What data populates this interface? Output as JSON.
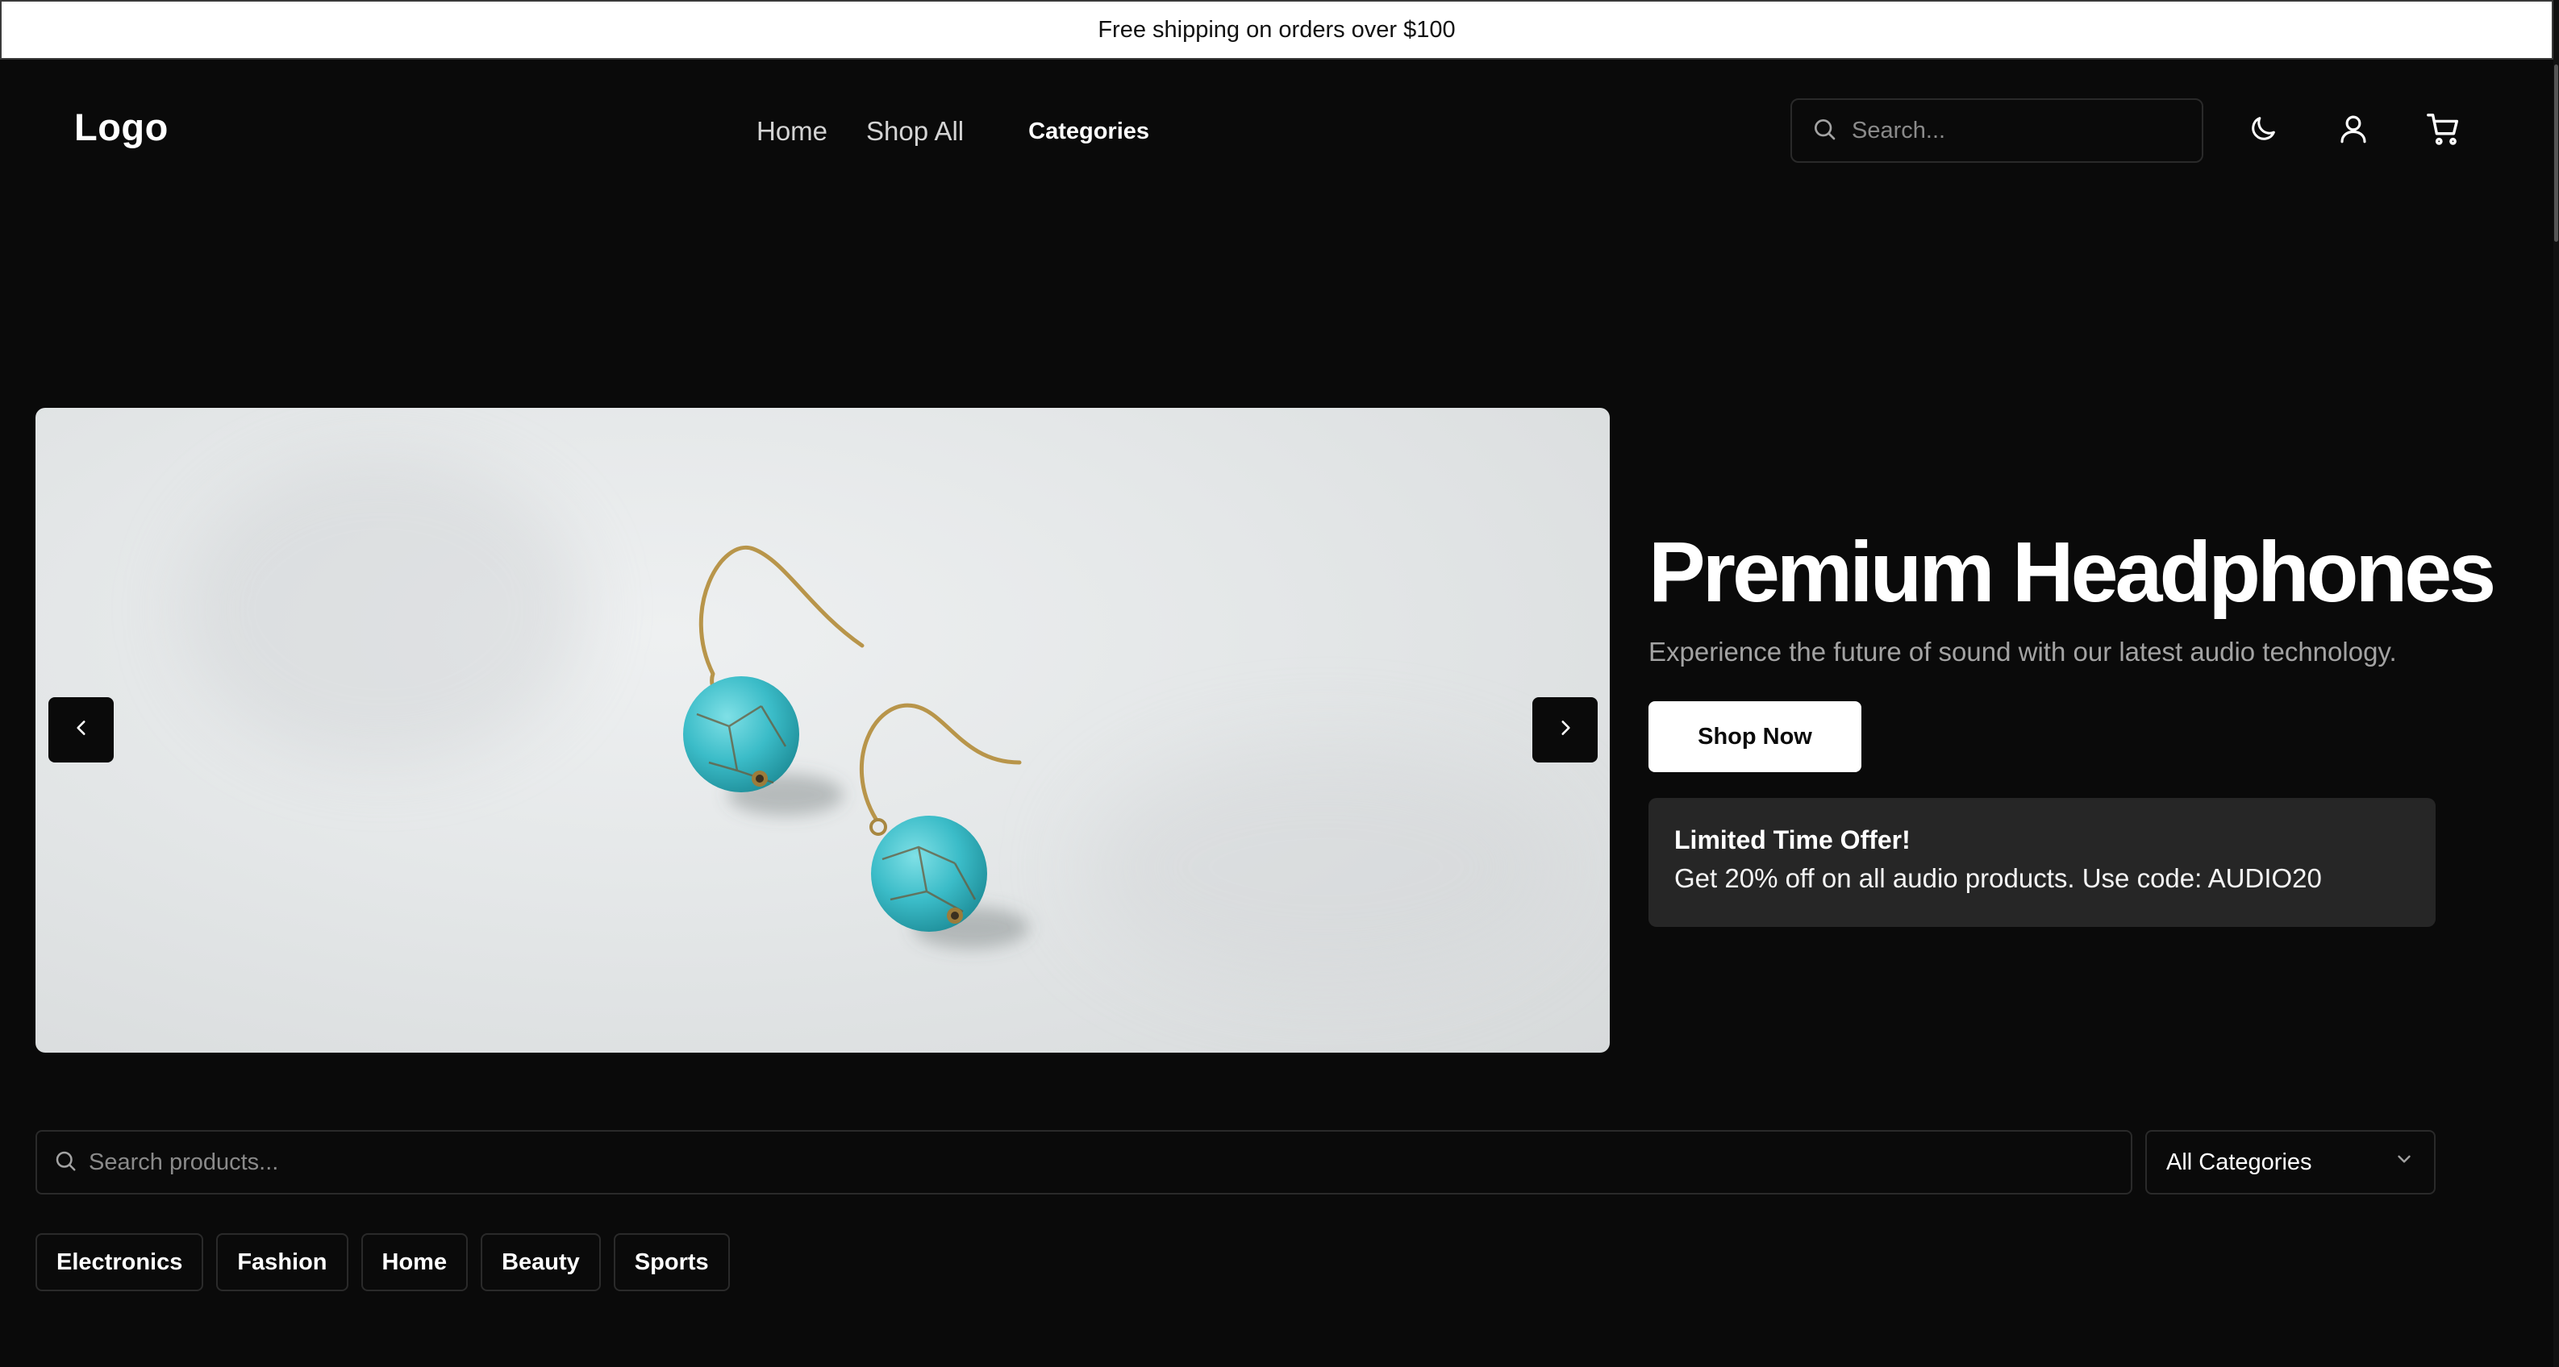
{
  "announcement": {
    "text": "Free shipping on orders over $100"
  },
  "header": {
    "logo": "Logo",
    "nav": {
      "home": "Home",
      "shop_all": "Shop All",
      "categories": "Categories"
    },
    "search": {
      "placeholder": "Search...",
      "value": ""
    },
    "icons": [
      "moon-icon",
      "user-icon",
      "cart-icon"
    ]
  },
  "hero": {
    "image_icon": "turquoise-earrings-photo",
    "title": "Premium Headphones",
    "subtitle": "Experience the future of sound with our latest audio technology.",
    "cta_label": "Shop Now",
    "offer": {
      "title": "Limited Time Offer!",
      "text": "Get 20% off on all audio products. Use code: AUDIO20"
    }
  },
  "filters": {
    "search_placeholder": "Search products...",
    "search_value": "",
    "category_selected": "All Categories",
    "chips": [
      "Electronics",
      "Fashion",
      "Home",
      "Beauty",
      "Sports"
    ]
  },
  "colors": {
    "background": "#0a0a0a",
    "announcement_bg": "#ffffff",
    "offer_bg": "#262626",
    "muted_text": "#a3a3a3"
  }
}
